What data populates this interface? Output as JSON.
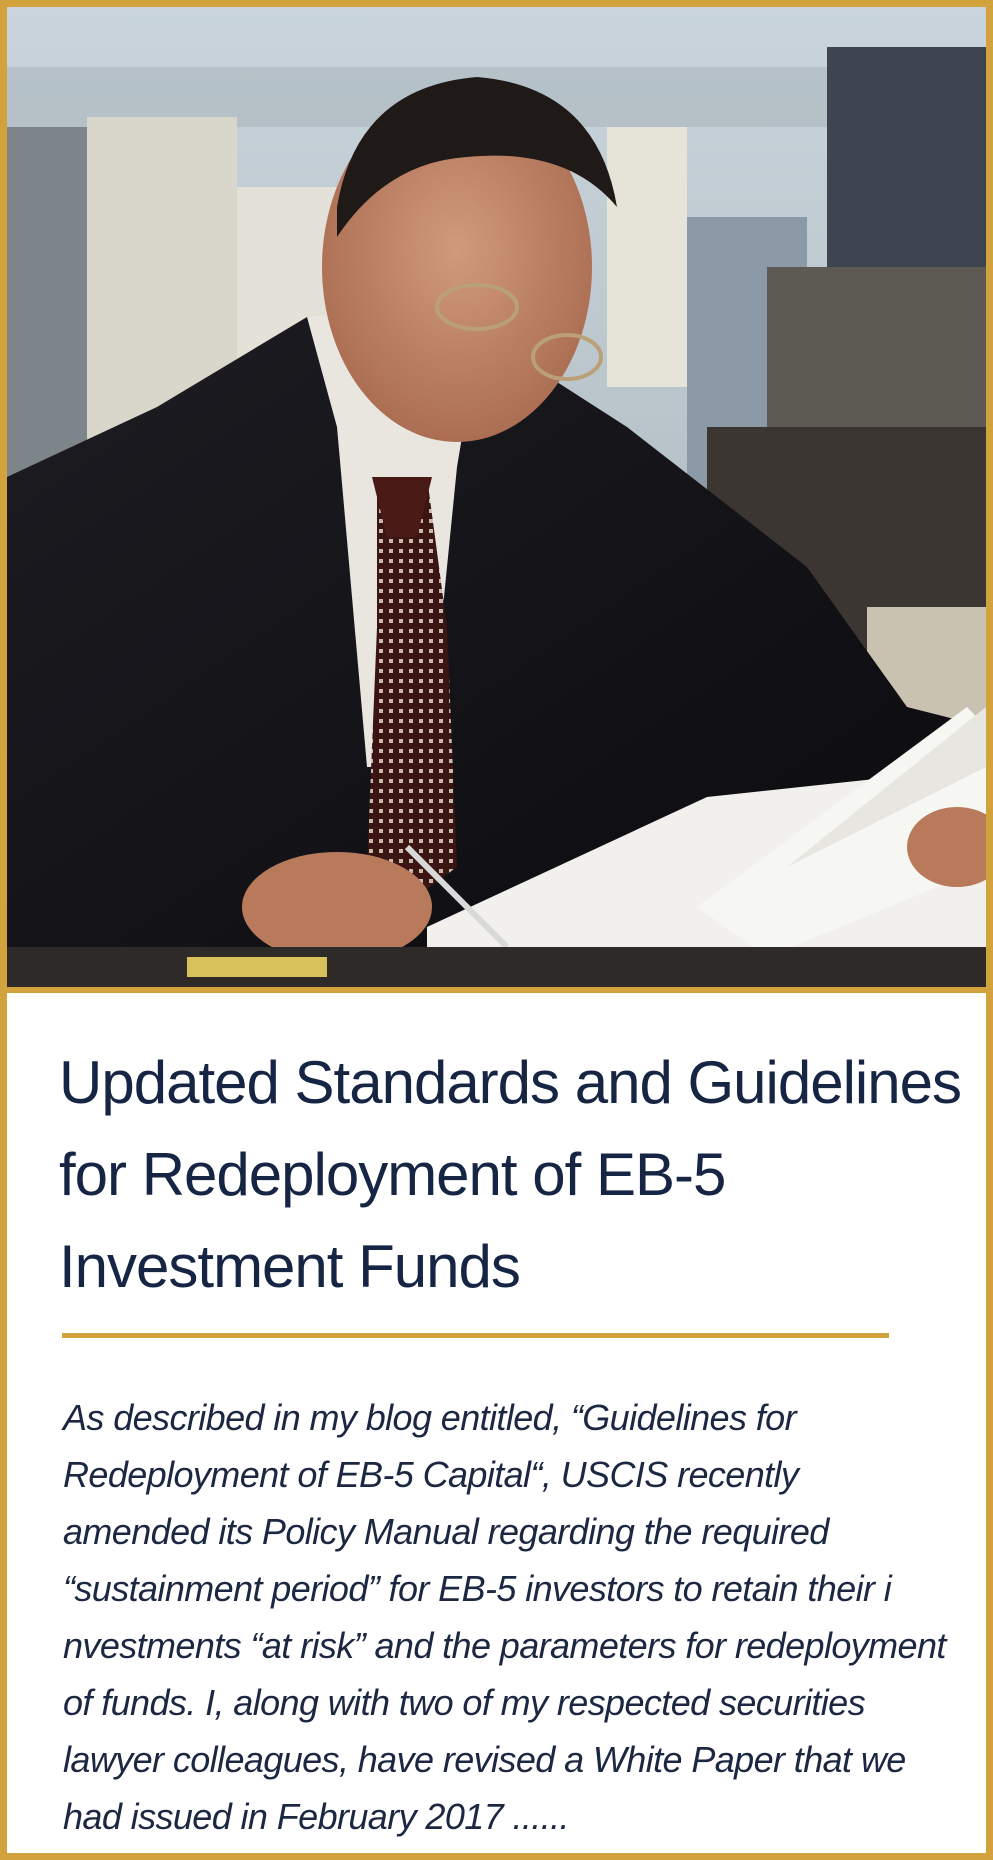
{
  "card": {
    "accent_color": "#d2a23c",
    "text_color": "#172544",
    "image_alt": "Businessman in suit and glasses reviewing documents at a desk with a city skyline in the background",
    "title_lines": [
      "Updated Standards and Guidelines",
      "for Redeployment of EB-5",
      "Investment Funds"
    ],
    "excerpt_lines": [
      "As described in my blog entitled, “Guidelines for",
      "Redeployment of EB-5 Capital“, USCIS recently",
      "amended its Policy Manual regarding the required",
      "“sustainment period” for EB-5 investors to retain their i",
      "nvestments “at risk” and the parameters for redeployment",
      "of funds. I, along with two of my respected securities",
      "lawyer colleagues, have revised a White Paper that we",
      "had issued in February 2017  ......"
    ]
  }
}
